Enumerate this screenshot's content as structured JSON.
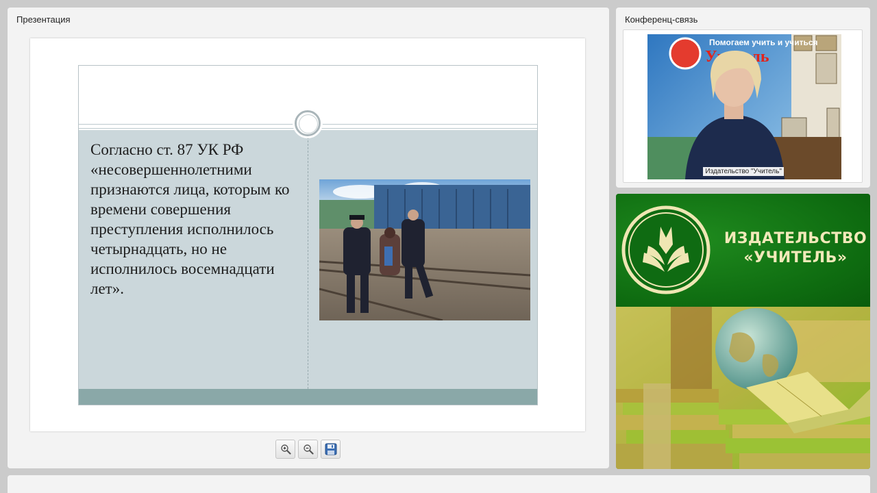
{
  "presentation": {
    "title": "Презентация",
    "slide_text": "Согласно ст. 87 УК РФ «несовершеннолетними признаются лица, которым ко времени совершения преступления исполнилось четырнадцать, но не исполнилось восемнадцати лет».",
    "photo_icon": "police-photo"
  },
  "toolbar": {
    "zoom_in_icon": "zoom-in-icon",
    "zoom_out_icon": "zoom-out-icon",
    "save_icon": "save-icon"
  },
  "conference": {
    "title": "Конференц-связь",
    "caption": "Издательство \"Учитель\""
  },
  "publisher": {
    "name_line1": "ИЗДАТЕЛЬСТВО",
    "name_line2": "«УЧИТЕЛЬ»"
  },
  "colors": {
    "slide_body": "#cbd7db",
    "slide_footer": "#8aa8a8",
    "banner_green": "#0e6b10",
    "banner_text": "#f2e9b9"
  }
}
